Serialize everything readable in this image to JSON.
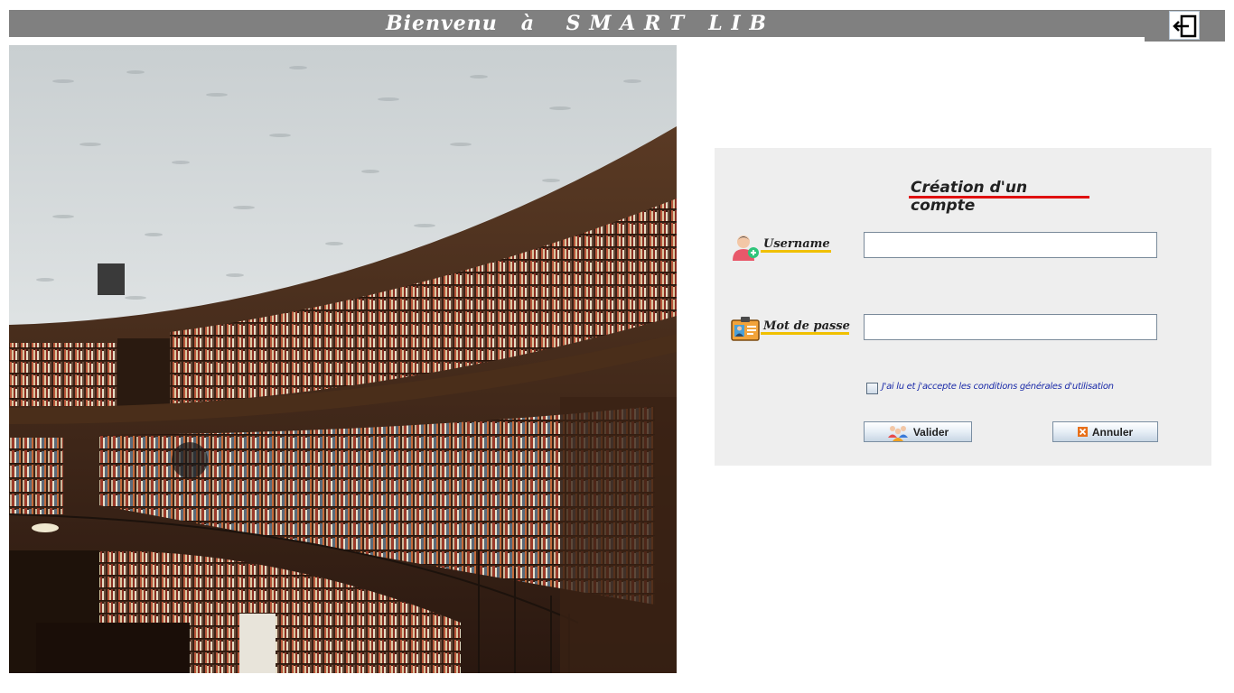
{
  "header": {
    "title": "Bienvenu   à    S M A R T   L I B",
    "exit_icon": "exit-icon"
  },
  "photo": {
    "icon": "library-photo"
  },
  "form": {
    "title": "Création d'un compte",
    "username": {
      "label": "Username",
      "value": "",
      "icon": "user-add-icon"
    },
    "password": {
      "label": "Mot de passe",
      "value": "",
      "icon": "id-card-icon"
    },
    "terms": {
      "label": "J'ai lu et j'accepte les conditions générales d'utilisation",
      "checked": false
    },
    "valider_label": "Valider",
    "annuler_label": "Annuler"
  },
  "colors": {
    "header_bg": "#808080",
    "title_underline": "#e01010",
    "label_underline": "#f0c000",
    "terms_text": "#1a2aa8"
  }
}
